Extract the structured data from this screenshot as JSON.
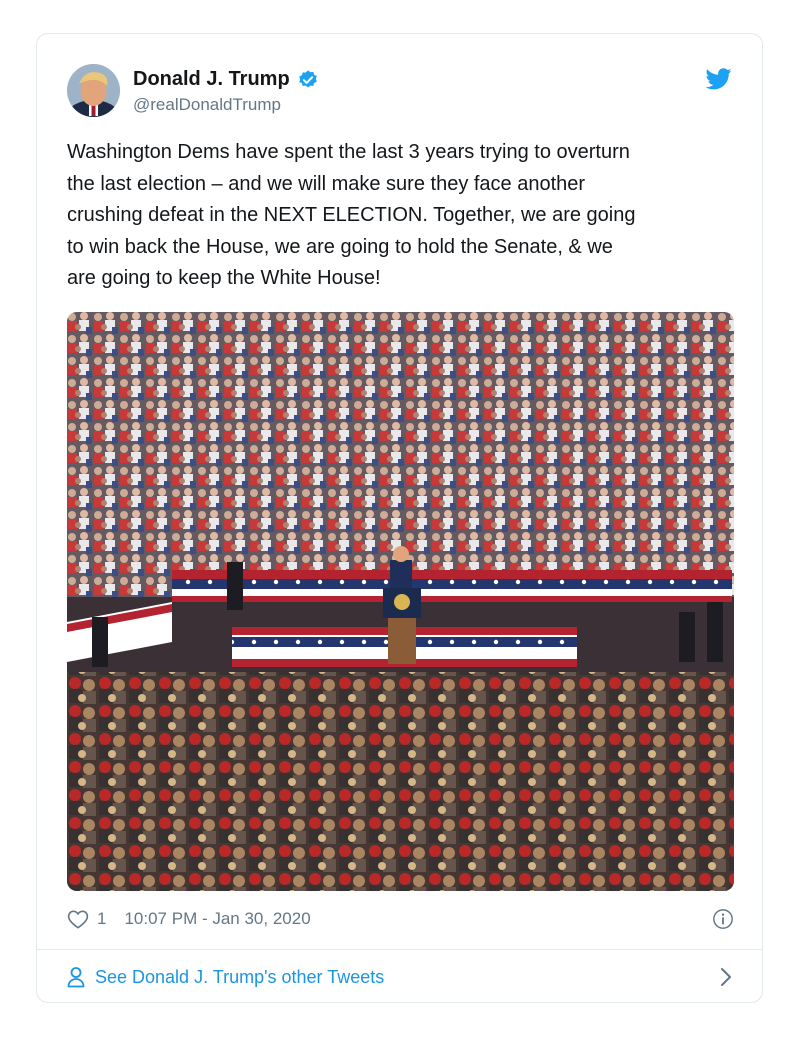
{
  "tweet": {
    "display_name": "Donald J. Trump",
    "handle": "@realDonaldTrump",
    "text": "Washington Dems have spent the last 3 years trying to overturn\nthe last election – and we will make sure they face another\ncrushing defeat in the NEXT ELECTION. Together, we are going\nto win back the House, we are going to hold the Senate, & we\nare going to keep the White House!",
    "like_count": "1",
    "timestamp": "10:07 PM - Jan 30, 2020"
  },
  "footer": {
    "other_tweets_label": "See Donald J. Trump's other Tweets"
  },
  "icons": {
    "brand": "twitter-bird-icon",
    "verified": "verified-badge-icon",
    "like": "heart-icon",
    "info": "info-icon",
    "profile": "person-icon",
    "chevron": "chevron-right-icon"
  },
  "colors": {
    "twitter_blue": "#1da1f2",
    "link_blue": "#1b95e0",
    "secondary_text": "#657786",
    "border": "#e1e8ed"
  }
}
